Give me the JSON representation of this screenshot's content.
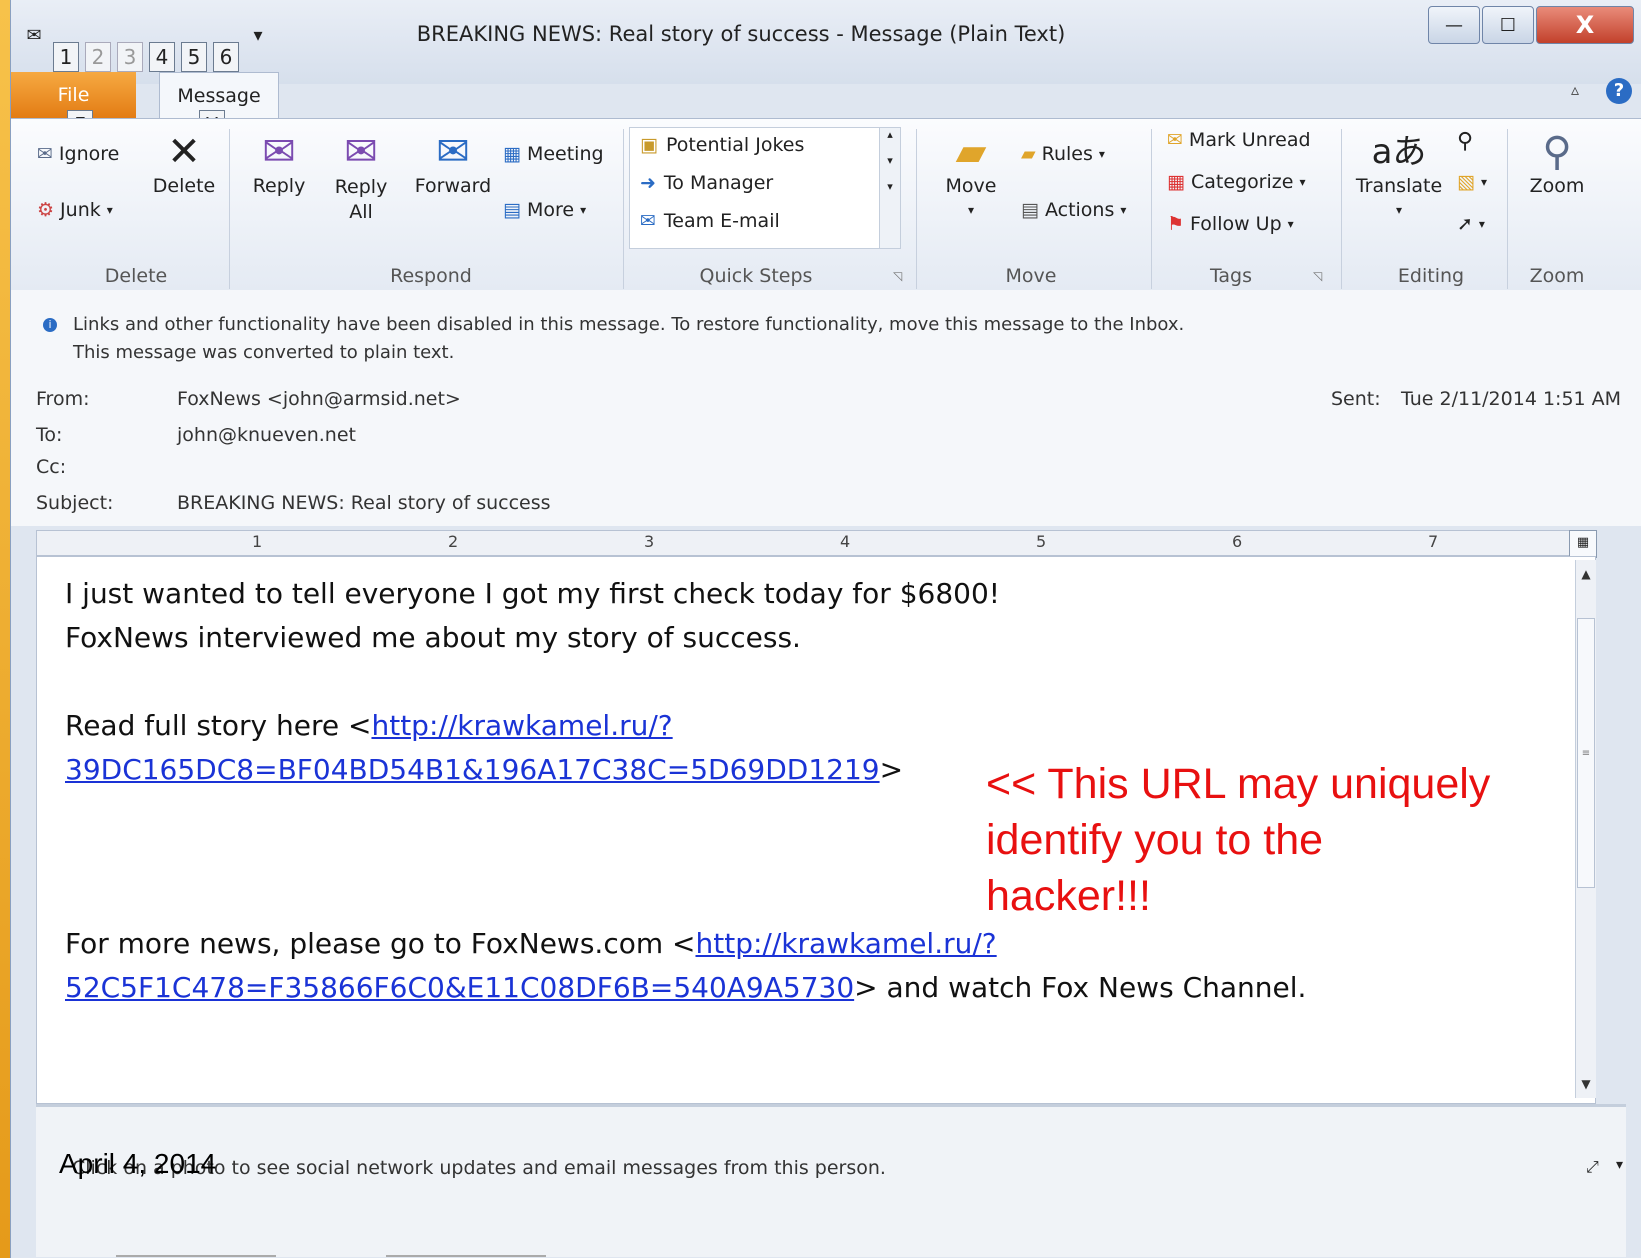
{
  "window": {
    "title": "BREAKING NEWS: Real story of success  -  Message (Plain Text)",
    "minimize": "—",
    "maximize": "☐",
    "close": "X"
  },
  "qat": {
    "keytips": [
      "1",
      "2",
      "3",
      "4",
      "5",
      "6"
    ]
  },
  "tabs": {
    "file": "File",
    "message": "Message",
    "keytip_file": "F",
    "keytip_message": "H"
  },
  "ribbon": {
    "delete_group": {
      "label": "Delete",
      "ignore": "Ignore",
      "junk": "Junk",
      "delete": "Delete"
    },
    "respond_group": {
      "label": "Respond",
      "reply": "Reply",
      "reply_all_1": "Reply",
      "reply_all_2": "All",
      "forward": "Forward",
      "meeting": "Meeting",
      "more": "More"
    },
    "quicksteps_group": {
      "label": "Quick Steps",
      "items": [
        "Potential Jokes",
        "To Manager",
        "Team E-mail"
      ]
    },
    "move_group": {
      "label": "Move",
      "move": "Move",
      "rules": "Rules",
      "actions": "Actions"
    },
    "tags_group": {
      "label": "Tags",
      "mark_unread": "Mark Unread",
      "categorize": "Categorize",
      "follow_up": "Follow Up"
    },
    "editing_group": {
      "label": "Editing",
      "translate": "Translate"
    },
    "zoom_group": {
      "label": "Zoom",
      "zoom": "Zoom"
    }
  },
  "infobar": {
    "line1": "Links and other functionality have been disabled in this message. To restore functionality, move this message to the Inbox.",
    "line2": "This message was converted to plain text."
  },
  "header": {
    "from_label": "From:",
    "from": "FoxNews <john@armsid.net>",
    "to_label": "To:",
    "to": "john@knueven.net",
    "cc_label": "Cc:",
    "subject_label": "Subject:",
    "subject": "BREAKING NEWS: Real story of success",
    "sent_label": "Sent:",
    "sent": "Tue 2/11/2014 1:51 AM"
  },
  "ruler": {
    "numbers": [
      "1",
      "2",
      "3",
      "4",
      "5",
      "6",
      "7"
    ]
  },
  "body": {
    "line1": "I just wanted to tell everyone I got my first check today for $6800!",
    "line2": "FoxNews interviewed me about my story of success.",
    "line3_prefix": "Read full story here <",
    "link1_part1": "http://krawkamel.ru/?",
    "link1_part2": "39DC165DC8=BF04BD54B1&196A17C38C=5D69DD1219",
    "link1_suffix": ">",
    "line5_prefix": "For more news, please go to FoxNews.com <",
    "link2_part1": "http://krawkamel.ru/?",
    "link2_part2": "52C5F1C478=F35866F6C0&E11C08DF6B=540A9A5730",
    "link2_suffix": ">  and watch Fox News Channel."
  },
  "annotation": {
    "line1": "<< This URL may uniquely",
    "line2": "identify you to the",
    "line3": "hacker!!!"
  },
  "people_pane": {
    "text": "Click on a photo to see social network updates and email messages from this person."
  },
  "slide_date": "April 4, 2014"
}
